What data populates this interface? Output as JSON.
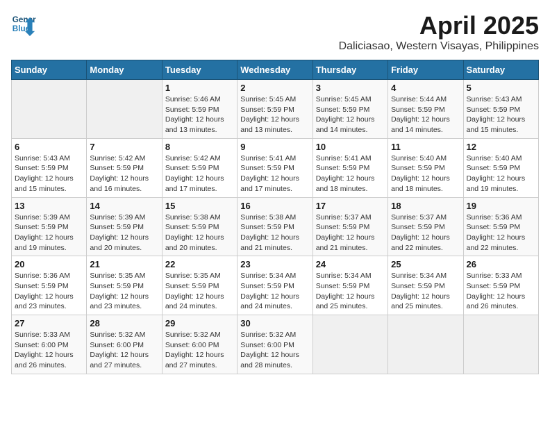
{
  "header": {
    "logo_line1": "General",
    "logo_line2": "Blue",
    "title": "April 2025",
    "subtitle": "Daliciasao, Western Visayas, Philippines"
  },
  "calendar": {
    "weekdays": [
      "Sunday",
      "Monday",
      "Tuesday",
      "Wednesday",
      "Thursday",
      "Friday",
      "Saturday"
    ],
    "weeks": [
      [
        {
          "day": "",
          "info": ""
        },
        {
          "day": "",
          "info": ""
        },
        {
          "day": "1",
          "info": "Sunrise: 5:46 AM\nSunset: 5:59 PM\nDaylight: 12 hours and 13 minutes."
        },
        {
          "day": "2",
          "info": "Sunrise: 5:45 AM\nSunset: 5:59 PM\nDaylight: 12 hours and 13 minutes."
        },
        {
          "day": "3",
          "info": "Sunrise: 5:45 AM\nSunset: 5:59 PM\nDaylight: 12 hours and 14 minutes."
        },
        {
          "day": "4",
          "info": "Sunrise: 5:44 AM\nSunset: 5:59 PM\nDaylight: 12 hours and 14 minutes."
        },
        {
          "day": "5",
          "info": "Sunrise: 5:43 AM\nSunset: 5:59 PM\nDaylight: 12 hours and 15 minutes."
        }
      ],
      [
        {
          "day": "6",
          "info": "Sunrise: 5:43 AM\nSunset: 5:59 PM\nDaylight: 12 hours and 15 minutes."
        },
        {
          "day": "7",
          "info": "Sunrise: 5:42 AM\nSunset: 5:59 PM\nDaylight: 12 hours and 16 minutes."
        },
        {
          "day": "8",
          "info": "Sunrise: 5:42 AM\nSunset: 5:59 PM\nDaylight: 12 hours and 17 minutes."
        },
        {
          "day": "9",
          "info": "Sunrise: 5:41 AM\nSunset: 5:59 PM\nDaylight: 12 hours and 17 minutes."
        },
        {
          "day": "10",
          "info": "Sunrise: 5:41 AM\nSunset: 5:59 PM\nDaylight: 12 hours and 18 minutes."
        },
        {
          "day": "11",
          "info": "Sunrise: 5:40 AM\nSunset: 5:59 PM\nDaylight: 12 hours and 18 minutes."
        },
        {
          "day": "12",
          "info": "Sunrise: 5:40 AM\nSunset: 5:59 PM\nDaylight: 12 hours and 19 minutes."
        }
      ],
      [
        {
          "day": "13",
          "info": "Sunrise: 5:39 AM\nSunset: 5:59 PM\nDaylight: 12 hours and 19 minutes."
        },
        {
          "day": "14",
          "info": "Sunrise: 5:39 AM\nSunset: 5:59 PM\nDaylight: 12 hours and 20 minutes."
        },
        {
          "day": "15",
          "info": "Sunrise: 5:38 AM\nSunset: 5:59 PM\nDaylight: 12 hours and 20 minutes."
        },
        {
          "day": "16",
          "info": "Sunrise: 5:38 AM\nSunset: 5:59 PM\nDaylight: 12 hours and 21 minutes."
        },
        {
          "day": "17",
          "info": "Sunrise: 5:37 AM\nSunset: 5:59 PM\nDaylight: 12 hours and 21 minutes."
        },
        {
          "day": "18",
          "info": "Sunrise: 5:37 AM\nSunset: 5:59 PM\nDaylight: 12 hours and 22 minutes."
        },
        {
          "day": "19",
          "info": "Sunrise: 5:36 AM\nSunset: 5:59 PM\nDaylight: 12 hours and 22 minutes."
        }
      ],
      [
        {
          "day": "20",
          "info": "Sunrise: 5:36 AM\nSunset: 5:59 PM\nDaylight: 12 hours and 23 minutes."
        },
        {
          "day": "21",
          "info": "Sunrise: 5:35 AM\nSunset: 5:59 PM\nDaylight: 12 hours and 23 minutes."
        },
        {
          "day": "22",
          "info": "Sunrise: 5:35 AM\nSunset: 5:59 PM\nDaylight: 12 hours and 24 minutes."
        },
        {
          "day": "23",
          "info": "Sunrise: 5:34 AM\nSunset: 5:59 PM\nDaylight: 12 hours and 24 minutes."
        },
        {
          "day": "24",
          "info": "Sunrise: 5:34 AM\nSunset: 5:59 PM\nDaylight: 12 hours and 25 minutes."
        },
        {
          "day": "25",
          "info": "Sunrise: 5:34 AM\nSunset: 5:59 PM\nDaylight: 12 hours and 25 minutes."
        },
        {
          "day": "26",
          "info": "Sunrise: 5:33 AM\nSunset: 5:59 PM\nDaylight: 12 hours and 26 minutes."
        }
      ],
      [
        {
          "day": "27",
          "info": "Sunrise: 5:33 AM\nSunset: 6:00 PM\nDaylight: 12 hours and 26 minutes."
        },
        {
          "day": "28",
          "info": "Sunrise: 5:32 AM\nSunset: 6:00 PM\nDaylight: 12 hours and 27 minutes."
        },
        {
          "day": "29",
          "info": "Sunrise: 5:32 AM\nSunset: 6:00 PM\nDaylight: 12 hours and 27 minutes."
        },
        {
          "day": "30",
          "info": "Sunrise: 5:32 AM\nSunset: 6:00 PM\nDaylight: 12 hours and 28 minutes."
        },
        {
          "day": "",
          "info": ""
        },
        {
          "day": "",
          "info": ""
        },
        {
          "day": "",
          "info": ""
        }
      ]
    ]
  }
}
